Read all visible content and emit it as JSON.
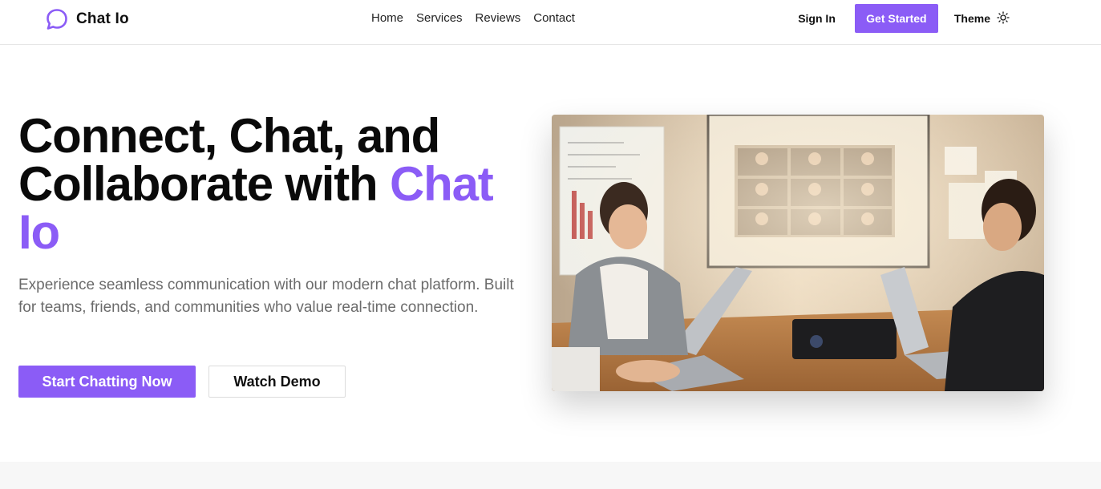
{
  "nav": {
    "brand": "Chat Io",
    "links": [
      "Home",
      "Services",
      "Reviews",
      "Contact"
    ],
    "sign_in": "Sign In",
    "get_started": "Get Started",
    "theme": "Theme"
  },
  "hero": {
    "title_line1": "Connect, Chat, and",
    "title_line2": "Collaborate with ",
    "title_accent": "Chat Io",
    "description": "Experience seamless communication with our modern chat platform. Built for teams, friends, and communities who value real-time connection.",
    "primary_cta": "Start Chatting Now",
    "secondary_cta": "Watch Demo"
  },
  "colors": {
    "accent": "#8b5cf6",
    "text": "#0a0a0a",
    "muted": "#6b6b6b"
  },
  "icons": {
    "logo": "chat-bubble-icon",
    "theme": "sun-icon"
  }
}
